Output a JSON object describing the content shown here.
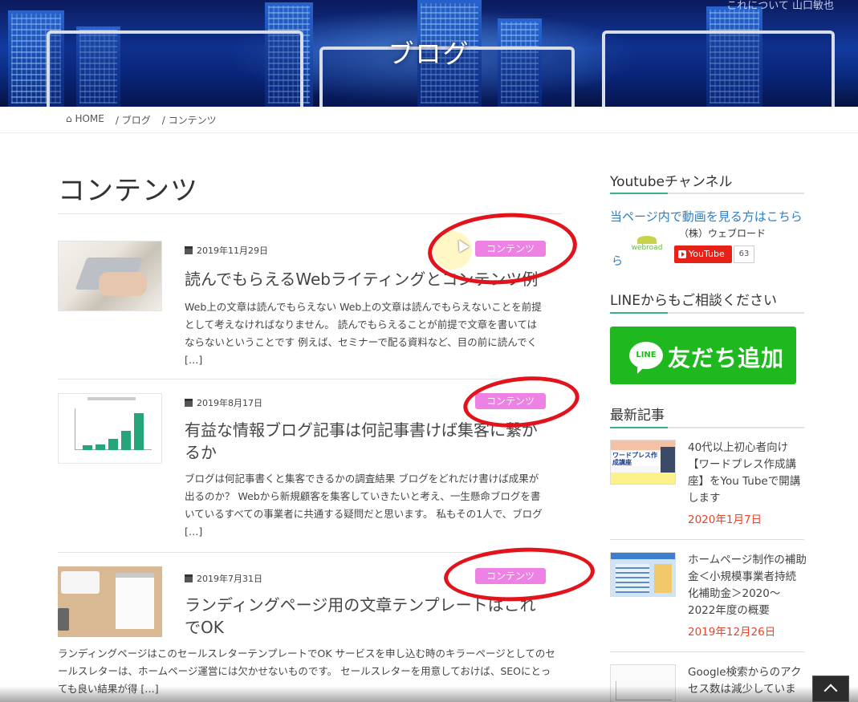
{
  "hero": {
    "title": "ブログ",
    "corner_text": "これについて 山口敏也"
  },
  "breadcrumb": {
    "home": "HOME",
    "items": [
      "/ ブログ",
      "/ コンテンツ"
    ]
  },
  "page_title": "コンテンツ",
  "posts": [
    {
      "date": "2019年11月29日",
      "tag": "コンテンツ",
      "title": "読んでもらえるWebライティングとコンテンツ例",
      "excerpt": "Web上の文章は読んでもらえない Web上の文章は読んでもらえないことを前提として考えなければなりません。 読んでもらえることが前提で文章を書いてはならないということです 例えば、セミナーで配る資料など、目の前に読んでく […]"
    },
    {
      "date": "2019年8月17日",
      "tag": "コンテンツ",
      "title": "有益な情報ブログ記事は何記事書けば集客に繋がるか",
      "excerpt": "ブログは何記事書くと集客できるかの調査結果 ブログをどれだけ書けば成果が出るのか？ Webから新規顧客を集客していきたいと考え、一生懸命ブログを書いているすべての事業者に共通する疑問だと思います。 私もその1人で、ブログ […]"
    },
    {
      "date": "2019年7月31日",
      "tag": "コンテンツ",
      "title": "ランディングページ用の文章テンプレートはこれでOK",
      "excerpt": "ランディングページはこのセールスレターテンプレートでOK サービスを申し込む時のキラーページとしてのセールスレターは、ホームページ運営には欠かせないものです。 セールスレターを用意しておけば、SEOにとっても良い結果が得 […]"
    }
  ],
  "sidebar": {
    "youtube_heading": "Youtubeチャンネル",
    "youtube_link": "当ページ内で動画を見る方はこちら",
    "youtube_link_tail": "ら",
    "webroad_logo": "webroad",
    "company_name": "（株）ウェブロード",
    "youtube_button": "YouTube",
    "youtube_count": "63",
    "line_heading": "LINEからもご相談ください",
    "line_icon": "LINE",
    "line_button": "友だち追加",
    "recent_heading": "最新記事",
    "recent": [
      {
        "title": "40代以上初心者向け【ワードプレス作成講座】をYou Tubeで開講します",
        "date": "2020年1月7日",
        "thumb_text": "ワードプレス作成講座"
      },
      {
        "title": "ホームページ制作の補助金＜小規模事業者持続化補助金＞2020〜2022年度の概要",
        "date": "2019年12月26日"
      },
      {
        "title": "Google検索からのアクセス数は減少していま",
        "date": ""
      }
    ]
  },
  "colors": {
    "tag_bg": "#ee82e4",
    "line_green": "#1fb91f",
    "date_red": "#e8442c",
    "link_blue": "#2a7fc8",
    "annotation_red": "#e3131b"
  }
}
